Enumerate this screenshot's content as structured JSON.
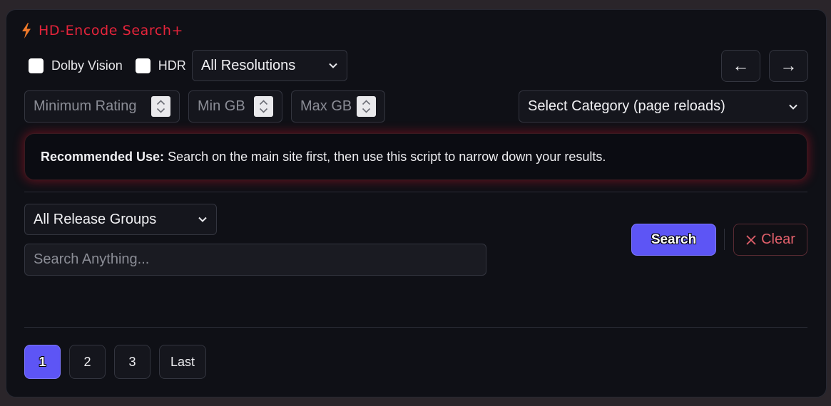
{
  "header": {
    "title": "HD-Encode Search+",
    "icon": "lightning-bolt-icon",
    "accent": "#e5243b"
  },
  "filters": {
    "dolby_vision_label": "Dolby Vision",
    "hdr_label": "HDR",
    "resolution_selected": "All Resolutions",
    "min_rating_placeholder": "Minimum Rating",
    "min_gb_placeholder": "Min GB",
    "max_gb_placeholder": "Max GB",
    "category_selected": "Select Category (page reloads)",
    "release_group_selected": "All Release Groups"
  },
  "nav": {
    "prev_label": "←",
    "next_label": "→"
  },
  "info": {
    "label": "Recommended Use:",
    "text": "Search on the main site first, then use this script to narrow down your results."
  },
  "search": {
    "placeholder": "Search Anything...",
    "search_label": "Search",
    "clear_label": "Clear"
  },
  "pagination": {
    "pages": [
      "1",
      "2",
      "3"
    ],
    "last_label": "Last",
    "active": "1"
  },
  "colors": {
    "primary": "#5d55f5",
    "danger": "#e2606b",
    "panel": "#0f1016"
  }
}
